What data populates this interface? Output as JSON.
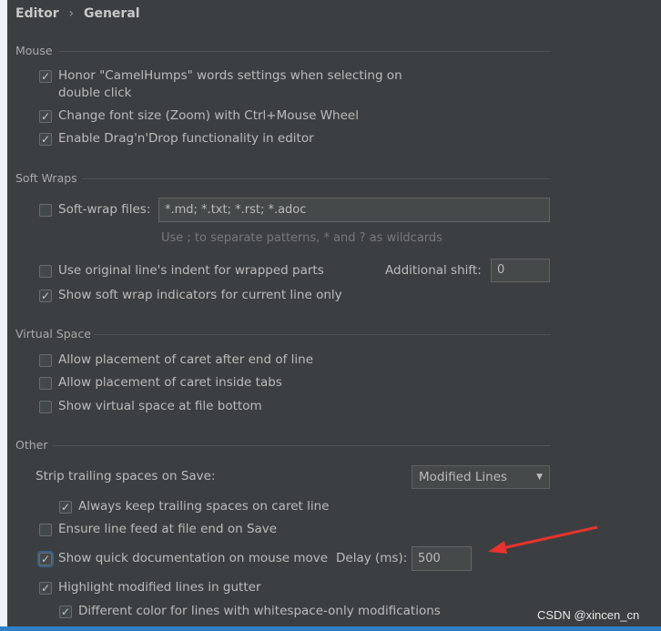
{
  "breadcrumb": {
    "parent": "Editor",
    "separator": "›",
    "current": "General"
  },
  "sections": {
    "mouse": "Mouse",
    "soft_wraps": "Soft Wraps",
    "virtual_space": "Virtual Space",
    "other": "Other"
  },
  "mouse": [
    {
      "label": "Honor \"CamelHumps\" words settings when selecting on",
      "label2": "double click",
      "checked": true
    },
    {
      "label": "Change font size (Zoom) with Ctrl+Mouse Wheel",
      "checked": true
    },
    {
      "label": "Enable Drag'n'Drop functionality in editor",
      "checked": true
    }
  ],
  "soft_wraps": {
    "files_label": "Soft-wrap files:",
    "files_checked": false,
    "files_value": "*.md; *.txt; *.rst; *.adoc",
    "hint": "Use ; to separate patterns, * and ? as wildcards",
    "indent_label": "Use original line's indent for wrapped parts",
    "indent_checked": false,
    "shift_label": "Additional shift:",
    "shift_value": "0",
    "indicators_label": "Show soft wrap indicators for current line only",
    "indicators_checked": true
  },
  "virtual_space": [
    {
      "label": "Allow placement of caret after end of line",
      "checked": false
    },
    {
      "label": "Allow placement of caret inside tabs",
      "checked": false
    },
    {
      "label": "Show virtual space at file bottom",
      "checked": false
    }
  ],
  "other": {
    "strip_label": "Strip trailing spaces on Save:",
    "strip_value": "Modified Lines",
    "keep_label": "Always keep trailing spaces on caret line",
    "keep_checked": true,
    "linefeed_label": "Ensure line feed at file end on Save",
    "linefeed_checked": false,
    "quickdoc_label": "Show quick documentation on mouse move",
    "quickdoc_checked": true,
    "delay_label": "Delay (ms):",
    "delay_value": "500",
    "highlight_label": "Highlight modified lines in gutter",
    "highlight_checked": true,
    "whitespace_label": "Different color for lines with whitespace-only modifications",
    "whitespace_checked": true
  },
  "watermark": "CSDN @xincen_cn",
  "colors": {
    "background": "#3c3f41",
    "annotation_arrow": "#e8322e",
    "focus": "#3d6185"
  }
}
